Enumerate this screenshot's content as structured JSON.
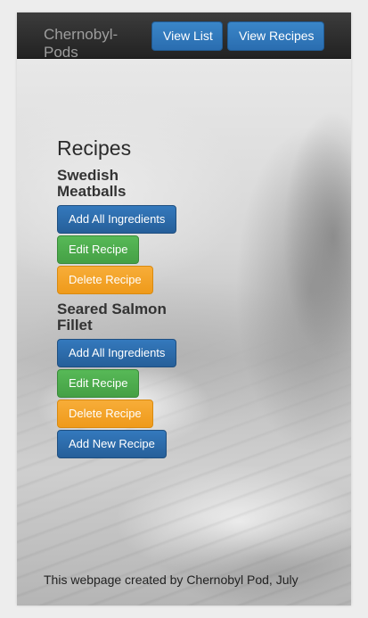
{
  "navbar": {
    "brand": "Chernobyl-Pods",
    "view_list": "View List",
    "view_recipes": "View Recipes"
  },
  "main": {
    "title": "Recipes",
    "recipes": [
      {
        "name": "Swedish Meatballs",
        "add_all": "Add All Ingredients",
        "edit": "Edit Recipe",
        "delete": "Delete Recipe"
      },
      {
        "name": "Seared Salmon Fillet",
        "add_all": "Add All Ingredients",
        "edit": "Edit Recipe",
        "delete": "Delete Recipe"
      }
    ],
    "add_new": "Add New Recipe"
  },
  "footer": {
    "text": "This webpage created by Chernobyl Pod, July"
  },
  "colors": {
    "navbar": "#222222",
    "primary": "#2a6db0",
    "success": "#4cae4c",
    "warning": "#f0a030"
  }
}
